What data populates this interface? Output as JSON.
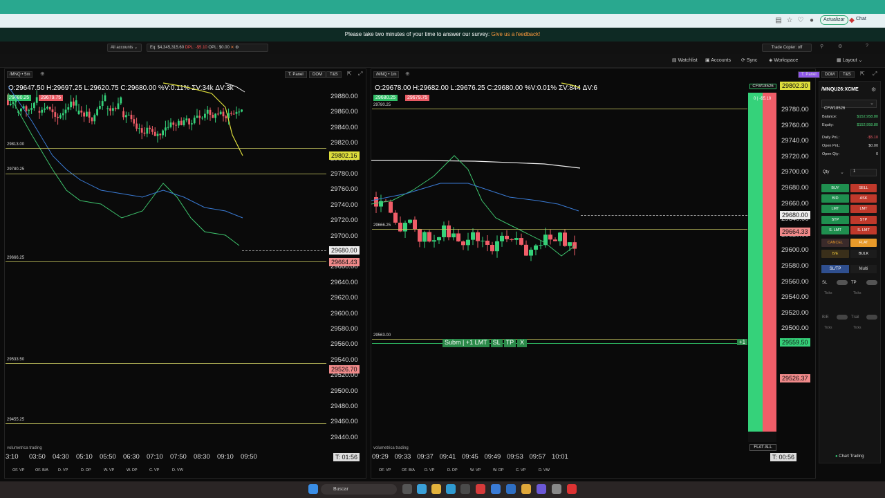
{
  "browser": {
    "update_label": "Actualizar",
    "chat_label": "Chat"
  },
  "survey": {
    "text": "Please take two minutes of your time to answer our survey:",
    "link": "Give us a feedback!"
  },
  "account_bar": {
    "accounts": "All accounts",
    "eq": "Eq: $4,345,315.60",
    "dpl": "DPL: -$5.10",
    "opl": "OPL: $0.00",
    "trade_copier": "Trade Copier: off"
  },
  "toolbar": {
    "watchlist": "Watchlist",
    "accounts": "Accounts",
    "sync": "Sync",
    "workspace": "Workspace",
    "layout": "Layout"
  },
  "left_chart": {
    "symbol": "/MNQ",
    "timeframe": "5m",
    "buttons": [
      "T. Panel",
      "DOM",
      "T&S"
    ],
    "ohlc": "O:29647.50  H:29697.25  L:29620.75  C:29680.00  %V:0.11%  ΣV:34k  ΔV:3k",
    "bid_box": "29680.25",
    "ask_box": "29679.75",
    "y_labels": [
      "29880.00",
      "29860.00",
      "29840.00",
      "29820.00",
      "29800.00",
      "29780.00",
      "29760.00",
      "29740.00",
      "29720.00",
      "29700.00",
      "29680.00",
      "29660.00",
      "29640.00",
      "29620.00",
      "29600.00",
      "29580.00",
      "29560.00",
      "29540.00",
      "29520.00",
      "29500.00",
      "29480.00",
      "29460.00",
      "29440.00"
    ],
    "x_labels": [
      "3:10",
      "03:50",
      "04:30",
      "05:10",
      "05:50",
      "06:30",
      "07:10",
      "07:50",
      "08:30",
      "09:10",
      "09:50"
    ],
    "levels": [
      "29813.00",
      "29780.25",
      "29666.25",
      "29533.50",
      "29455.25"
    ],
    "price_yellow": "29802.16",
    "price_last": "29680.00",
    "price_red": "29664.43",
    "price_red2": "29526.70",
    "timer": "T: 01:56",
    "bottom_tabs": [
      "OF. VP",
      "OF. B/A",
      "D. VP",
      "D. DP",
      "W. VP",
      "W. DP",
      "C. VP",
      "D. VW"
    ],
    "brand": "volumetrica trading"
  },
  "right_chart": {
    "symbol": "/MNQ",
    "timeframe": "1m",
    "buttons": [
      "T. Panel",
      "DOM",
      "T&S"
    ],
    "ohlc": "O:29678.00  H:29682.00  L:29676.25  C:29680.00  %V:0.01%  ΣV:844  ΔV:6",
    "bid_box": "29680.25",
    "ask_box": "29679.75",
    "y_labels": [
      "29780.00",
      "29760.00",
      "29740.00",
      "29720.00",
      "29700.00",
      "29680.00",
      "29660.00",
      "29640.00",
      "29620.00",
      "29600.00",
      "29580.00",
      "29560.00",
      "29540.00",
      "29520.00",
      "29500.00",
      "29480.00"
    ],
    "x_labels": [
      "09:29",
      "09:33",
      "09:37",
      "09:41",
      "09:45",
      "09:49",
      "09:53",
      "09:57",
      "10:01"
    ],
    "levels": [
      "29780.25",
      "29666.25",
      "29563.00"
    ],
    "price_yellow": "29802.30",
    "price_last": "29680.00",
    "price_red": "29664.33",
    "price_green": "29559.50",
    "price_red2": "29526.37",
    "order_bar": [
      "Subm | +1 LMT",
      "SL",
      "TP",
      "X"
    ],
    "order_qty": "+1",
    "dom_account": "CFW18526",
    "dom_pnl": "0 | -$5.10",
    "flat_all": "FLAT ALL",
    "timer": "T: 00:56",
    "bottom_tabs": [
      "OF. VP",
      "OF. B/A",
      "D. VP",
      "D. DP",
      "W. VP",
      "W. DP",
      "C. VP",
      "D. VW"
    ],
    "brand": "volumetrica trading"
  },
  "trade_panel": {
    "symbol": "/MNQU26:XCME",
    "account": "CFW18526",
    "rows": [
      {
        "label": "Balance:",
        "value": "$152,958.80"
      },
      {
        "label": "Equity:",
        "value": "$152,958.80"
      },
      {
        "label": "Daily PnL:",
        "value": "-$5.10"
      },
      {
        "label": "Open PnL:",
        "value": "$0.00"
      },
      {
        "label": "Open Qty:",
        "value": "0"
      }
    ],
    "qty_label": "Qty",
    "qty_value": "1",
    "buttons": [
      [
        "BUY",
        "SELL"
      ],
      [
        "BID",
        "ASK"
      ],
      [
        "LMT",
        "LMT"
      ],
      [
        "STP",
        "STP"
      ],
      [
        "S. LMT",
        "S. LMT"
      ],
      [
        "CANCEL",
        "FLAT"
      ],
      [
        "B/E",
        "BULK"
      ]
    ],
    "tabs": [
      "SL/TP",
      "Multi"
    ],
    "sl": "SL",
    "tp": "TP",
    "ticks": "Ticks",
    "be": "B/E",
    "trail": "Trail",
    "footer": "Chart Trading"
  },
  "taskbar": {
    "search": "Buscar"
  }
}
